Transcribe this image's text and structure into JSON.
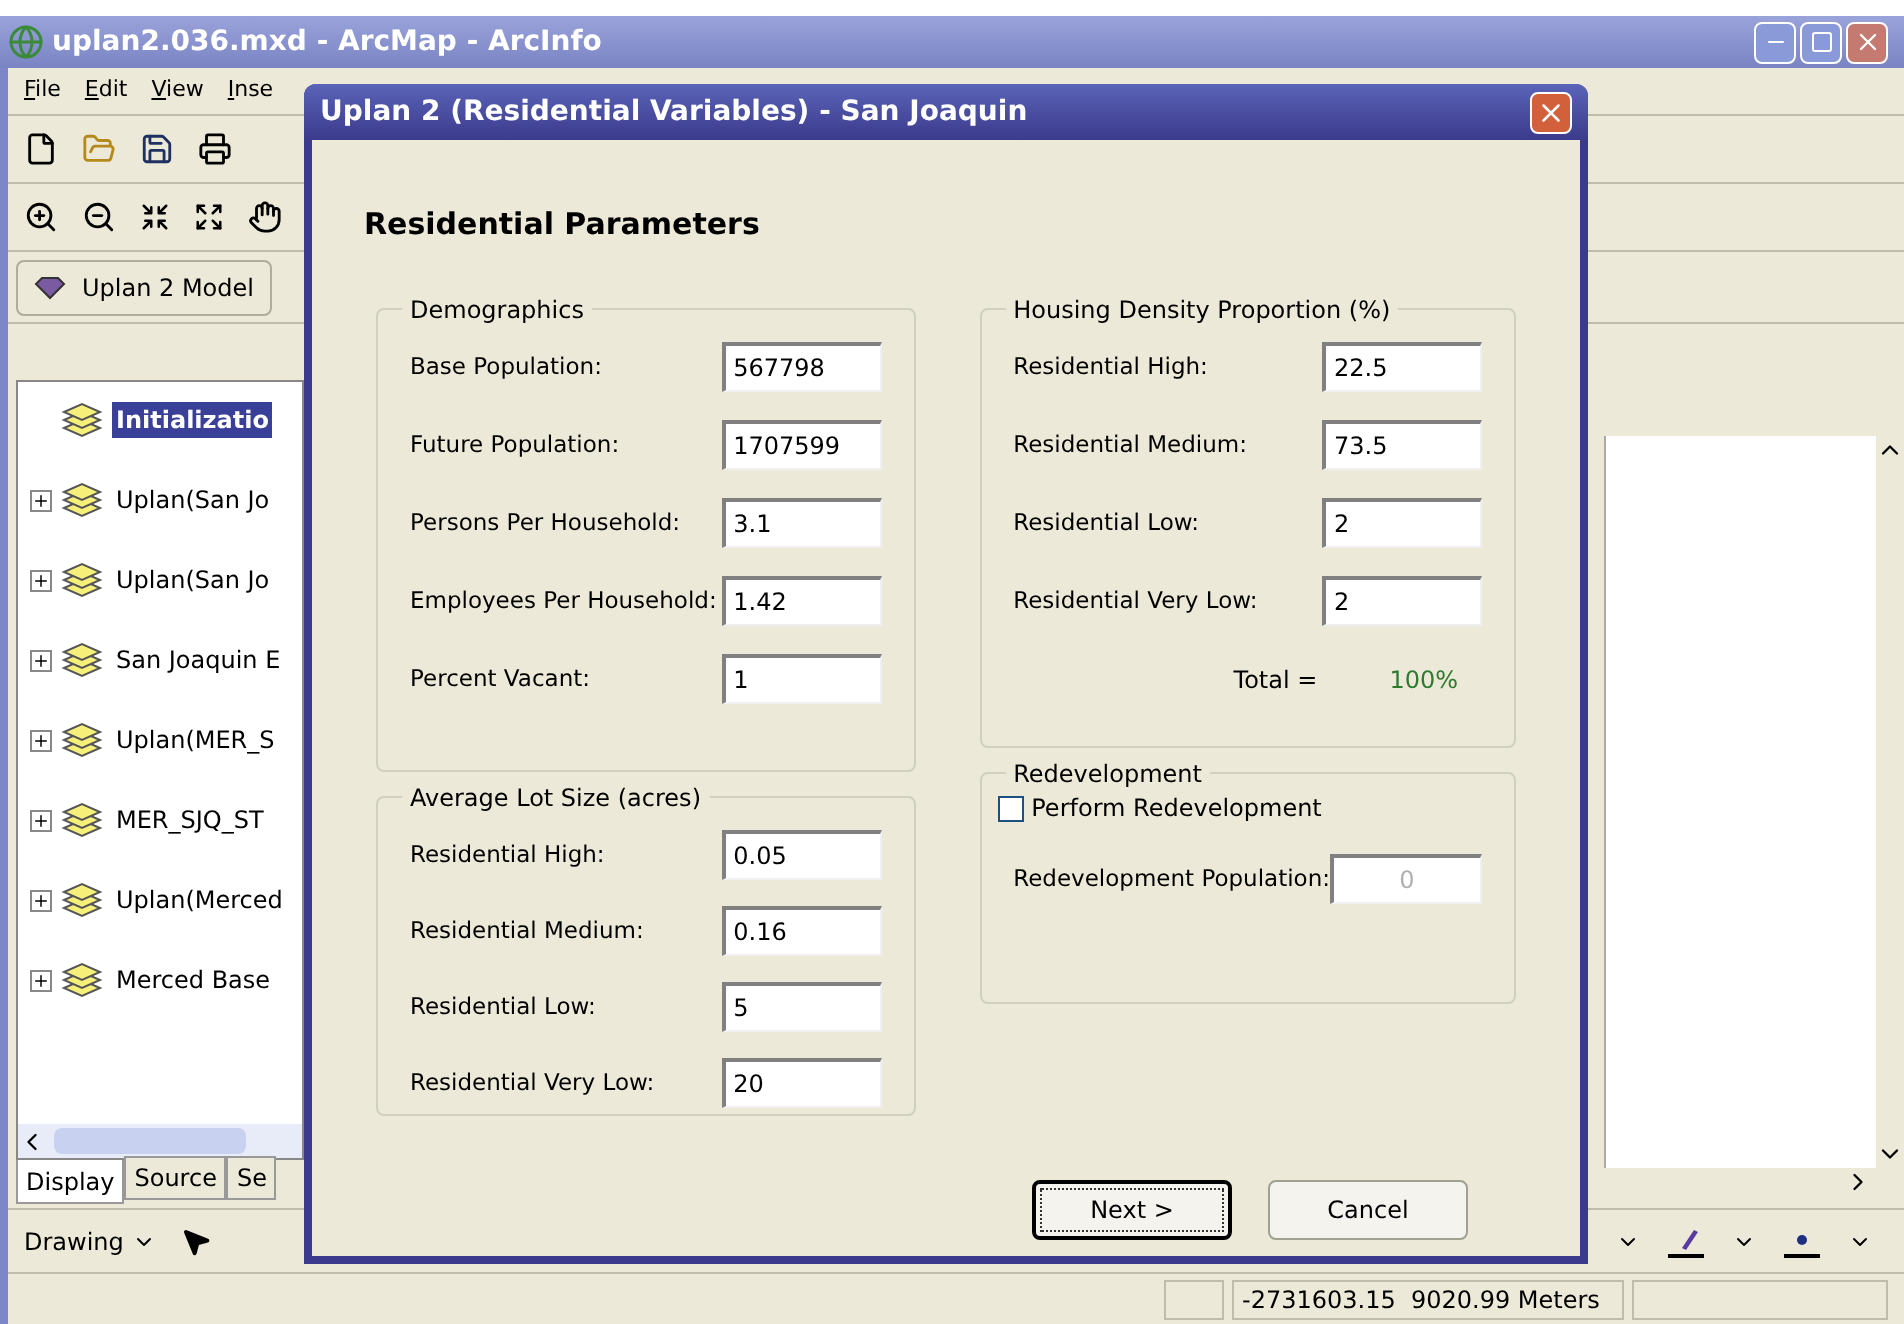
{
  "app": {
    "title": "uplan2.036.mxd - ArcMap - ArcInfo",
    "menu": [
      "File",
      "Edit",
      "View",
      "Inse"
    ],
    "model_button": "Uplan 2 Model",
    "layers": [
      {
        "label": "Initializatio",
        "expandable": false,
        "selected": true
      },
      {
        "label": "Uplan(San Jo",
        "expandable": true,
        "selected": false
      },
      {
        "label": "Uplan(San Jo",
        "expandable": true,
        "selected": false
      },
      {
        "label": "San Joaquin E",
        "expandable": true,
        "selected": false
      },
      {
        "label": "Uplan(MER_S",
        "expandable": true,
        "selected": false
      },
      {
        "label": "MER_SJQ_ST",
        "expandable": true,
        "selected": false
      },
      {
        "label": "Uplan(Merced",
        "expandable": true,
        "selected": false
      },
      {
        "label": "Merced Base",
        "expandable": true,
        "selected": false
      }
    ],
    "tabs": [
      {
        "label": "Display",
        "selected": true
      },
      {
        "label": "Source",
        "selected": false
      },
      {
        "label": "Se",
        "selected": false
      }
    ],
    "drawing_menu": "Drawing",
    "status": "-2731603.15  9020.99 Meters"
  },
  "dialog": {
    "title": "Uplan 2 (Residential Variables) - San Joaquin",
    "heading": "Residential Parameters",
    "demographics": {
      "title": "Demographics",
      "fields": [
        {
          "label": "Base Population:",
          "value": "567798"
        },
        {
          "label": "Future Population:",
          "value": "1707599"
        },
        {
          "label": "Persons Per Household:",
          "value": "3.1"
        },
        {
          "label": "Employees Per Household:",
          "value": "1.42"
        },
        {
          "label": "Percent Vacant:",
          "value": "1"
        }
      ]
    },
    "lot_size": {
      "title": "Average Lot Size (acres)",
      "fields": [
        {
          "label": "Residential High:",
          "value": "0.05"
        },
        {
          "label": "Residential Medium:",
          "value": "0.16"
        },
        {
          "label": "Residential Low:",
          "value": "5"
        },
        {
          "label": "Residential Very Low:",
          "value": "20"
        }
      ]
    },
    "housing_density": {
      "title": "Housing Density Proportion (%)",
      "fields": [
        {
          "label": "Residential High:",
          "value": "22.5"
        },
        {
          "label": "Residential Medium:",
          "value": "73.5"
        },
        {
          "label": "Residential Low:",
          "value": "2"
        },
        {
          "label": "Residential Very Low:",
          "value": "2"
        }
      ],
      "total_label": "Total =",
      "total_value": "100%"
    },
    "redevelopment": {
      "title": "Redevelopment",
      "checkbox": {
        "label": "Perform Redevelopment",
        "checked": false
      },
      "field": {
        "label": "Redevelopment Population:",
        "value": "0",
        "disabled": true
      }
    },
    "buttons": [
      {
        "label": "Next >",
        "default": true
      },
      {
        "label": "Cancel",
        "default": false
      }
    ]
  }
}
